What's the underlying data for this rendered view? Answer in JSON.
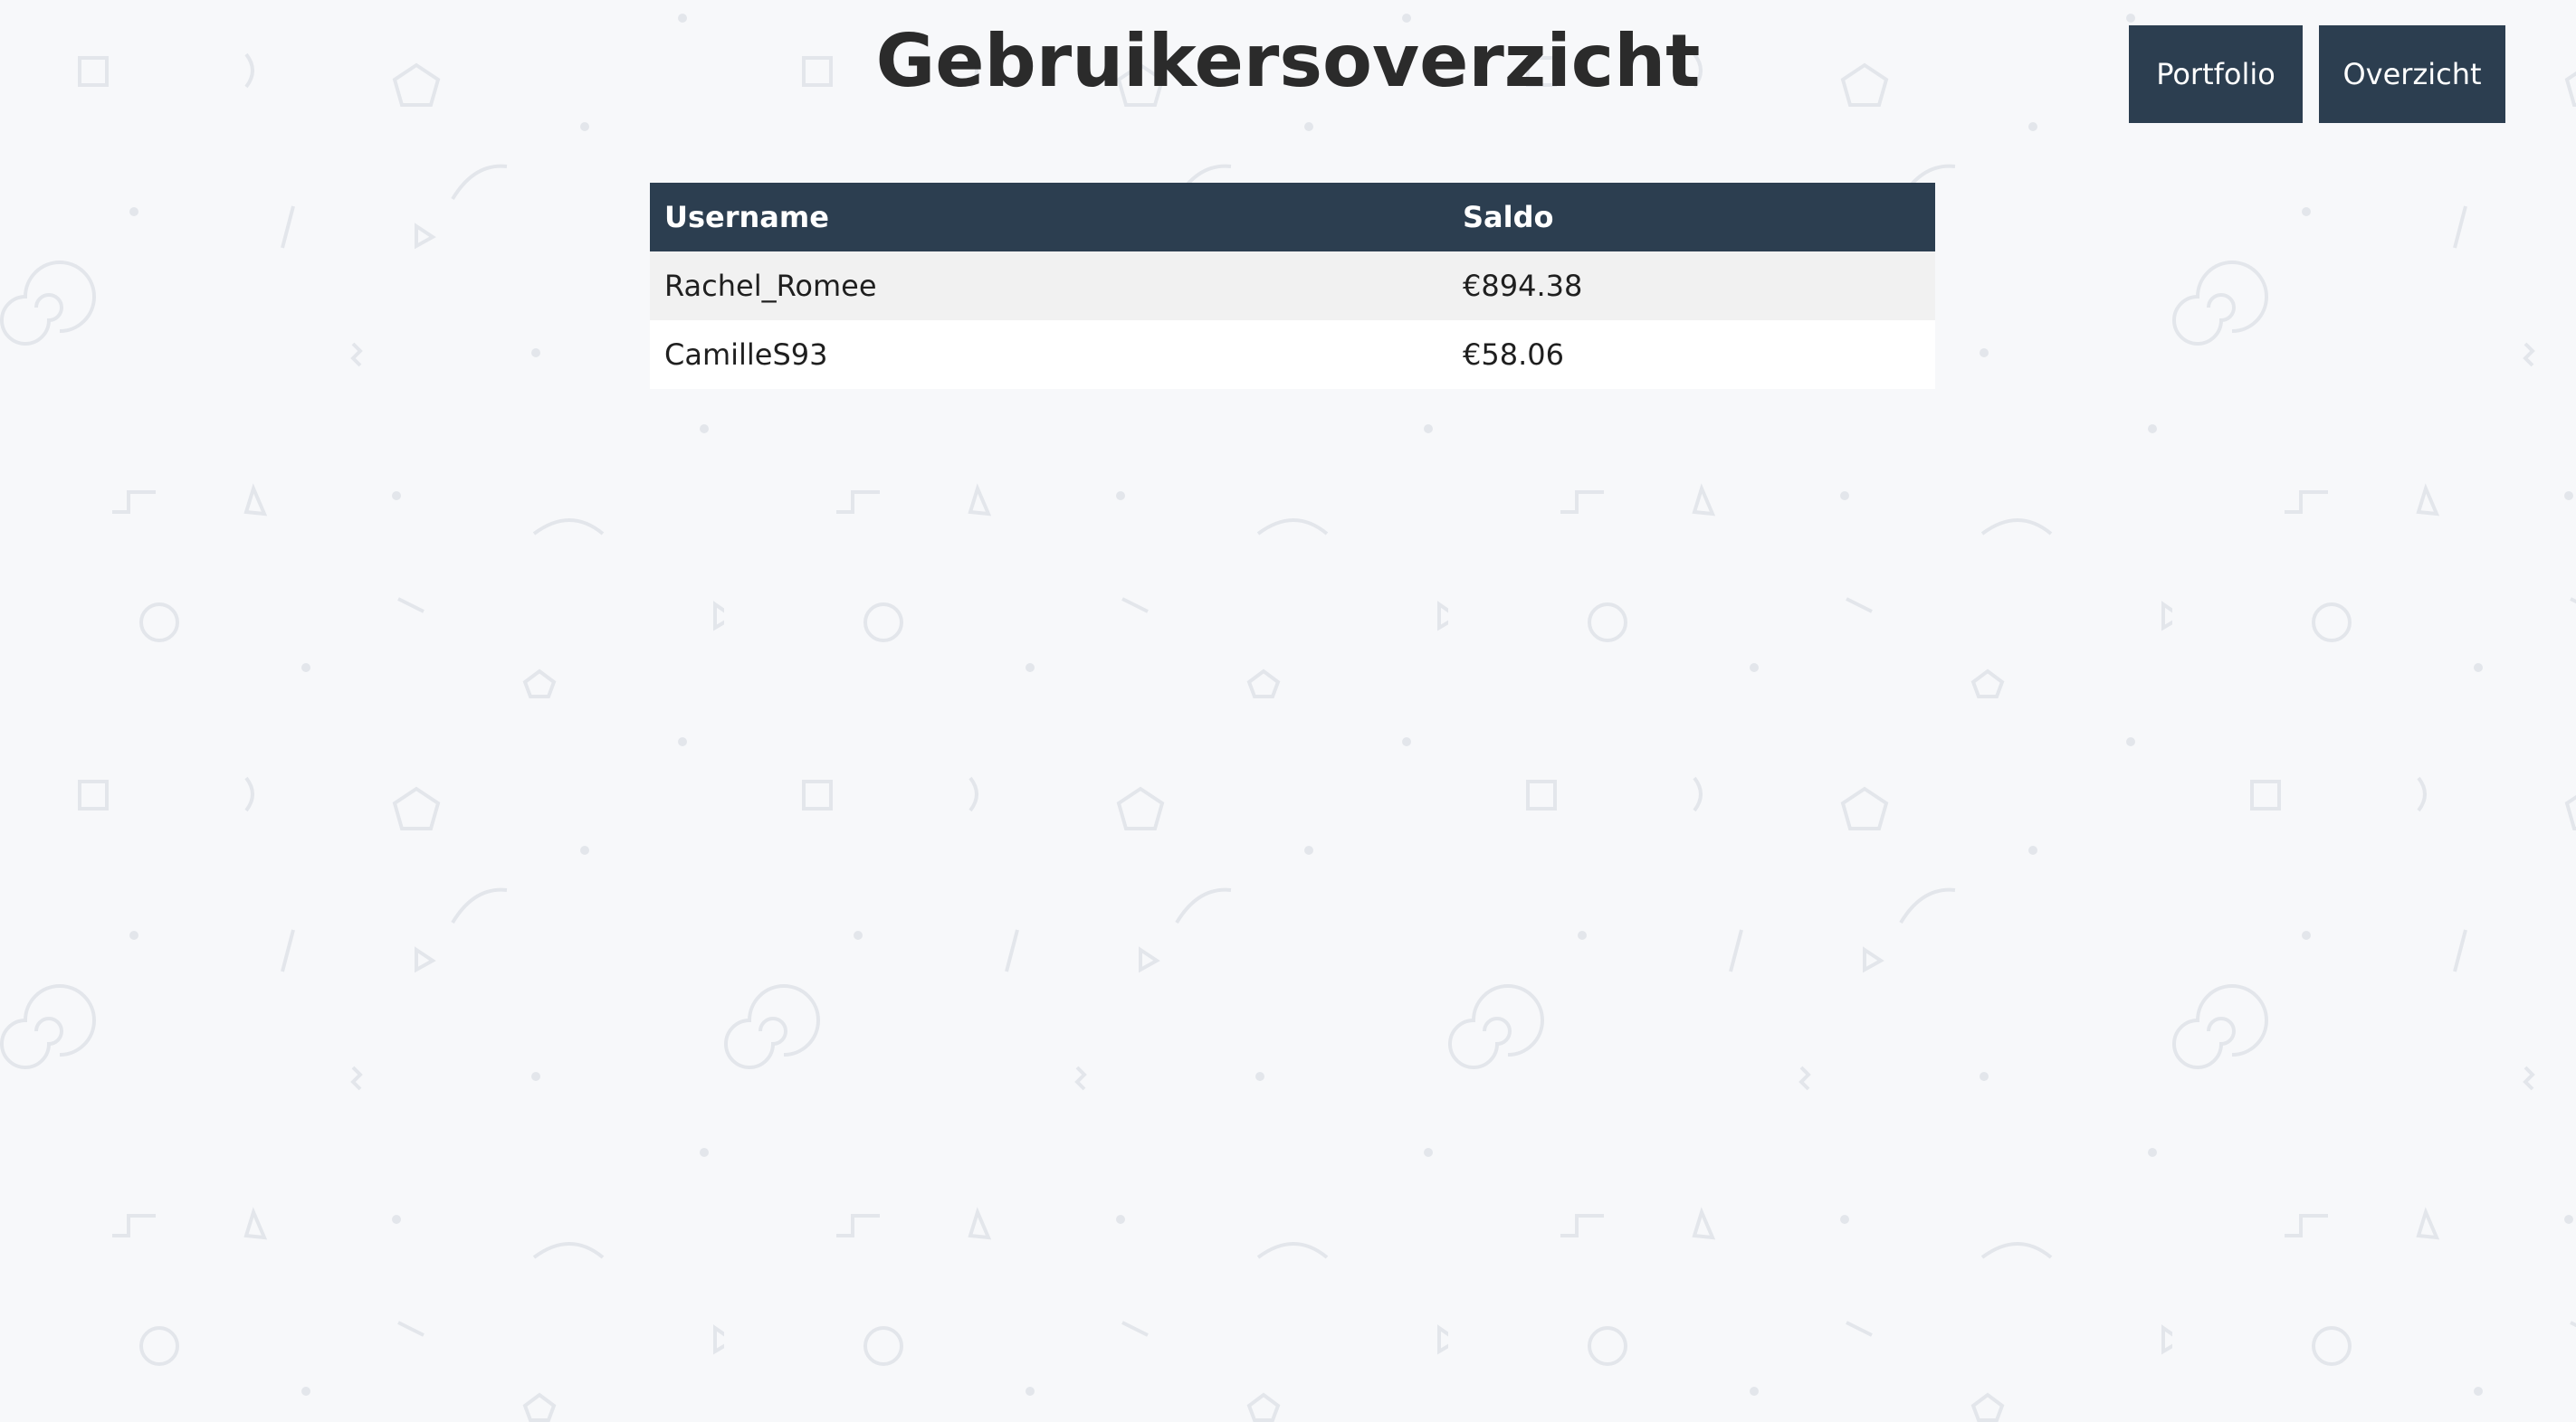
{
  "page": {
    "title": "Gebruikersoverzicht"
  },
  "nav": {
    "portfolio_label": "Portfolio",
    "overzicht_label": "Overzicht"
  },
  "table": {
    "headers": [
      "Username",
      "Saldo"
    ],
    "rows": [
      {
        "username": "Rachel_Romee",
        "saldo": "€894.38"
      },
      {
        "username": "CamilleS93",
        "saldo": "€58.06"
      }
    ]
  },
  "colors": {
    "background": "#f7f8fa",
    "accent": "#2c3e50",
    "row_alt": "#f1f1f1",
    "pattern": "#e3e6eb"
  }
}
